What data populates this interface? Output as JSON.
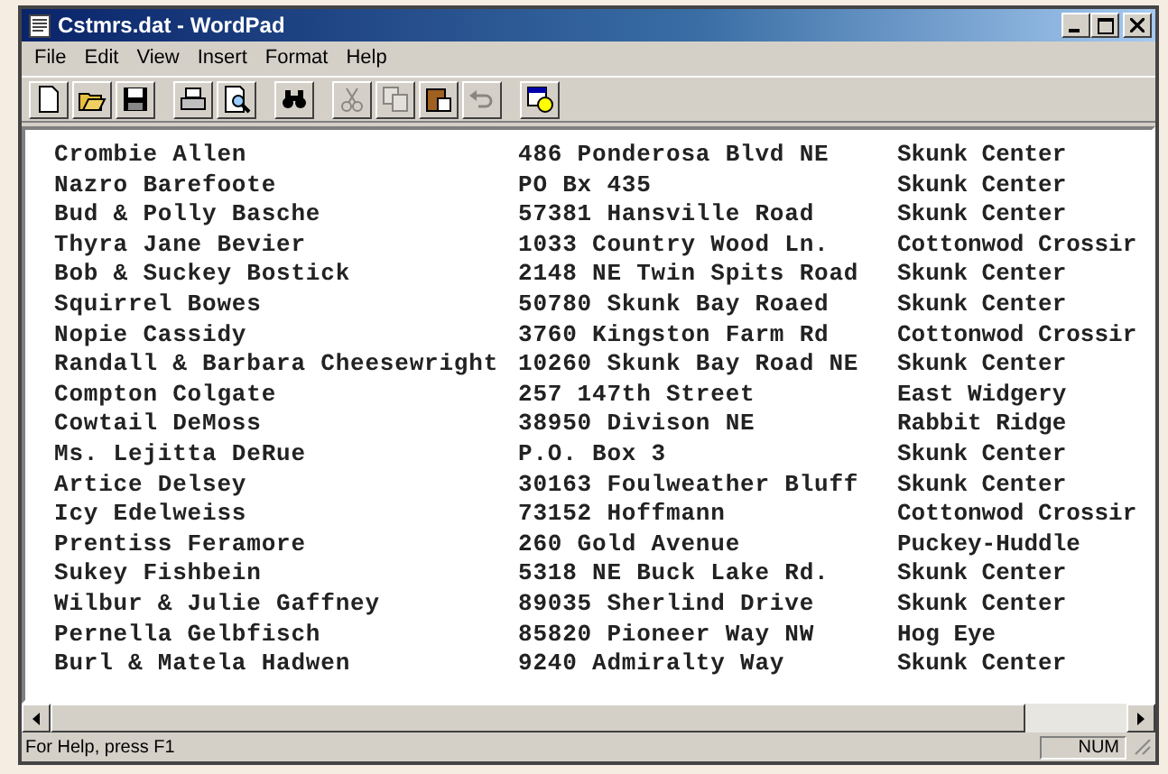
{
  "window": {
    "title": "Cstmrs.dat - WordPad"
  },
  "menu": [
    "File",
    "Edit",
    "View",
    "Insert",
    "Format",
    "Help"
  ],
  "toolbar": [
    {
      "kind": "new",
      "disabled": false
    },
    {
      "kind": "open",
      "disabled": false
    },
    {
      "kind": "save",
      "disabled": false
    },
    {
      "kind": "sep"
    },
    {
      "kind": "print",
      "disabled": false
    },
    {
      "kind": "preview",
      "disabled": false
    },
    {
      "kind": "sep"
    },
    {
      "kind": "find",
      "disabled": false
    },
    {
      "kind": "sep"
    },
    {
      "kind": "cut",
      "disabled": true
    },
    {
      "kind": "copy",
      "disabled": true
    },
    {
      "kind": "paste",
      "disabled": false
    },
    {
      "kind": "undo",
      "disabled": true
    },
    {
      "kind": "sep"
    },
    {
      "kind": "datetime",
      "disabled": false
    }
  ],
  "document": {
    "rows": [
      [
        "Crombie Allen",
        "486 Ponderosa Blvd NE",
        "Skunk Center"
      ],
      [
        "Nazro Barefoote",
        "PO Bx 435",
        "Skunk Center"
      ],
      [
        "Bud & Polly Basche",
        "57381 Hansville Road",
        "Skunk Center"
      ],
      [
        "Thyra Jane Bevier",
        "1033 Country Wood Ln.",
        "Cottonwod Crossir"
      ],
      [
        "Bob & Suckey Bostick",
        "2148 NE Twin Spits Road",
        "Skunk Center"
      ],
      [
        "Squirrel Bowes",
        "50780 Skunk Bay Roaed",
        "Skunk Center"
      ],
      [
        "Nopie Cassidy",
        "3760 Kingston Farm Rd",
        "Cottonwod Crossir"
      ],
      [
        "Randall & Barbara Cheesewright",
        "10260 Skunk Bay Road NE",
        "Skunk Center"
      ],
      [
        "Compton Colgate",
        "257 147th Street",
        "East Widgery"
      ],
      [
        "Cowtail DeMoss",
        "38950 Divison NE",
        "Rabbit Ridge"
      ],
      [
        "Ms. Lejitta DeRue",
        "P.O. Box 3",
        "Skunk Center"
      ],
      [
        "Artice Delsey",
        "30163 Foulweather Bluff",
        "Skunk Center"
      ],
      [
        "Icy Edelweiss",
        "73152 Hoffmann",
        "Cottonwod Crossir"
      ],
      [
        "Prentiss Feramore",
        "260 Gold Avenue",
        "Puckey-Huddle"
      ],
      [
        "Sukey Fishbein",
        "5318 NE Buck Lake Rd.",
        "Skunk Center"
      ],
      [
        "Wilbur & Julie Gaffney",
        "89035 Sherlind Drive",
        "Skunk Center"
      ],
      [
        "Pernella Gelbfisch",
        "85820 Pioneer Way NW",
        "Hog Eye"
      ],
      [
        "Burl & Matela Hadwen",
        "9240 Admiralty Way",
        "Skunk Center"
      ]
    ]
  },
  "status_bar": [
    "For Help, press F1",
    "NUM"
  ]
}
